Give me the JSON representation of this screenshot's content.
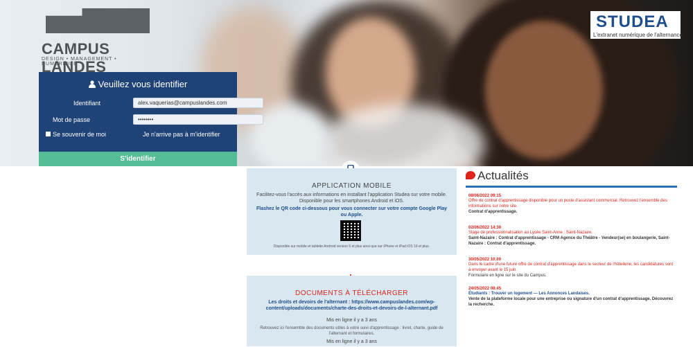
{
  "brand": {
    "title": "CAMPUS LANDES",
    "subtitle": "DESIGN • MANAGEMENT • NUMÉRIQUE"
  },
  "studea": {
    "title": "STUDEA",
    "subtitle": "L'extranet numérique de l'alternance"
  },
  "login": {
    "heading": "Veuillez vous identifier",
    "identifiant_label": "Identifiant",
    "identifiant_value": "alex.vaquerias@campuslandes.com",
    "password_label": "Mot de passe",
    "password_value": "••••••••",
    "remember_label": "Se souvenir de moi",
    "forgot_label": "Je n'arrive pas à m'identifier",
    "submit_label": "S'identifier"
  },
  "mobile": {
    "title": "APPLICATION MOBILE",
    "text1": "Facilitez-vous l'accès aux informations en installant l'application Studea sur votre mobile. Disponible pour les smartphones Android et iOS.",
    "text2": "Flashez le QR code ci-dessous pour vous connecter sur votre compte Google Play ou Apple.",
    "text3": "Disponible sur mobile et tablette Android version 5 et plus ainsi que sur iPhone et iPad iOS 10 et plus."
  },
  "documents": {
    "title": "DOCUMENTS À TÉLÉCHARGER",
    "link": "Les droits et devoirs de l'alternant : https://www.campuslandes.com/wp-content/uploads/documents/charte-des-droits-et-devoirs-de-l-alternant.pdf",
    "meta": "Mis en ligne il y a 3 ans",
    "text": "Retrouvez ici l'ensemble des documents utiles à votre suivi d'apprentissage : livret, charte, guide de l'alternant et formulaires.",
    "meta2": "Mis en ligne il y a 3 ans"
  },
  "news": {
    "heading": "Actualités",
    "items": [
      {
        "date": "08/06/2022 09:15",
        "text": "Offre de contrat d'apprentissage disponible pour un poste d'assistant commercial. Retrouvez l'ensemble des informations sur notre site.",
        "tail": "Contrat d'apprentissage."
      },
      {
        "date": "02/06/2022 14:30",
        "text": "Stage de professionnalisation au Lycée Saint-Anne : Saint-Nazaire.",
        "tail": "Saint-Nazaire : Contrat d'apprentissage - CRM Agence du Théâtre - Vendeur(se) en boulangerie, Saint-Nazaire : Contrat d'apprentissage."
      },
      {
        "date": "30/05/2022 10:00",
        "text": "Dans le cadre d'une future offre de contrat d'apprentissage dans le secteur de l'hôtellerie, les candidatures sont à envoyer avant le 15 juin.",
        "tail": "Formulaire en ligne sur le site du Campus."
      },
      {
        "date": "24/05/2022 08:45",
        "text": "Étudiants : Trouver un logement — Les Annonces Landaises.",
        "tail": "Vente de la plateforme locale pour une entreprise ou signature d'un contrat d'apprentissage. Découvrez la recherche."
      }
    ]
  },
  "colors": {
    "login_bg": "#1f4377",
    "submit_bg": "#55bc96",
    "panel_bg": "#d8e7f0",
    "accent_red": "#e0231a",
    "accent_blue": "#2d6fb8"
  }
}
